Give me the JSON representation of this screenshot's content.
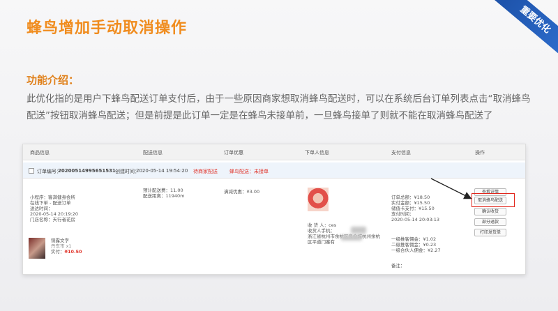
{
  "slide": {
    "title": "蜂鸟增加手动取消操作",
    "ribbon": "重要优化",
    "intro_heading": "功能介绍：",
    "intro_text": "此优化指的是用户下蜂鸟配送订单支付后，由于一些原因商家想取消蜂鸟配送时，可以在系统后台订单列表点击“取消蜂鸟配送”按钮取消蜂鸟配送；但是前提是此订单一定是在蜂鸟未接单前，一旦蜂鸟接单了则就不能在取消蜂鸟配送了"
  },
  "table": {
    "headers": [
      "商品信息",
      "配送信息",
      "订单优惠",
      "下单人信息",
      "支付信息",
      "操作"
    ],
    "order": {
      "number_label": "订单编号：",
      "number": "20200514995651531",
      "created_label": "创建时间：",
      "created": "2020-05-14 19:54:20",
      "status": "待商家配送",
      "fengniao_status": "蜂鸟配送：未接单"
    },
    "goods": {
      "lines": [
        "小程序：客满健身会所",
        "在线下单 - 配送订单",
        "送达时间：",
        "2020-05-14 20:19:20",
        "门店名称：天行者花房"
      ],
      "item_name": "铜露文字",
      "item_sub": "丹东市  x1",
      "item_price_label": "实付：",
      "item_price": "¥10.50"
    },
    "delivery": [
      "预计配送费：11.00",
      "配送距离：11940m"
    ],
    "discount": "满减优惠：¥3.00",
    "buyer": [
      "收 货 人：ces",
      "收货人手机：",
      "浙江省杭州市余杭区良仓城杭州余杭",
      "区平道门塞有"
    ],
    "payment": [
      "订单总额：¥18.50",
      "实付金额：¥15.50",
      "储值卡支付：¥15.50",
      "支付时间：",
      "2020-05-14 20:03:13"
    ],
    "commission": [
      "一级推客佣金：¥1.02",
      "二级推客佣金：¥0.23",
      "一级合伙人佣金：¥2.27"
    ],
    "remark": "备注：",
    "actions": [
      "查看详情",
      "取消蜂鸟配送",
      "确认收货",
      "部分退款",
      "打印发货单"
    ]
  },
  "colors": {
    "title": "#f08c1e",
    "highlight": "#e1261c",
    "ribbon": "#1b4fa5"
  }
}
